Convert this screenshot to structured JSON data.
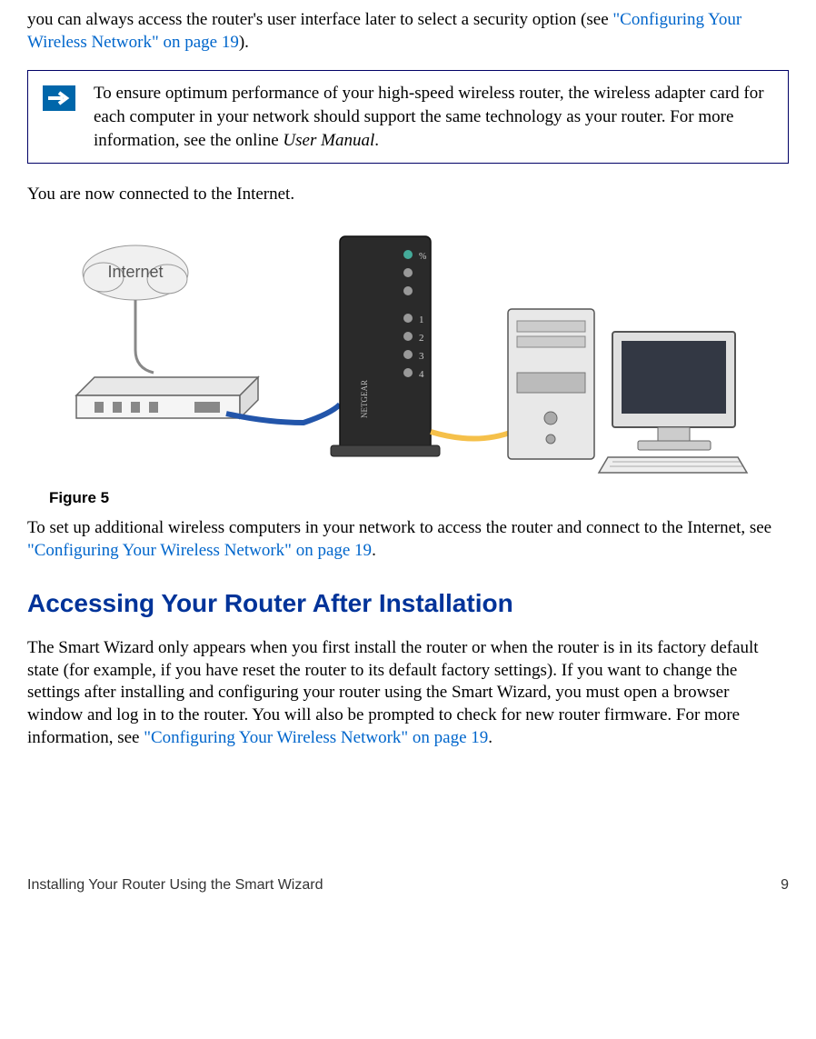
{
  "intro": {
    "line1": "you can always access the router's user interface later to select a security option (see ",
    "link1": "\"Configuring Your Wireless Network\" on page 19",
    "line1_end": ")."
  },
  "note": {
    "text_before_italic": "To ensure optimum performance of your high-speed wireless router, the wireless adapter card for each computer in your network should support the same technology as your router. For more information, see the online ",
    "italic": "User Manual",
    "text_after_italic": "."
  },
  "connected_text": "You are now connected to the Internet.",
  "figure": {
    "caption": "Figure 5",
    "internet_label": "Internet"
  },
  "setup_text": {
    "before_link": "To set up additional wireless computers in your network to access the router and connect to the Internet, see ",
    "link": "\"Configuring Your Wireless Network\" on page 19",
    "after_link": "."
  },
  "heading": "Accessing Your Router After Installation",
  "body_text": {
    "before_link": "The Smart Wizard only appears when you first install the router or when the router is in its factory default state (for example, if you have reset the router to its default factory settings). If you want to change the settings after installing and configuring your router using the Smart Wizard, you must open a browser window and log in to the router. You will also be prompted to check for new router firmware. For more information, see ",
    "link": "\"Configuring Your Wireless Network\" on page 19",
    "after_link": "."
  },
  "footer": {
    "left": "Installing Your Router Using the Smart Wizard",
    "right": "9"
  }
}
